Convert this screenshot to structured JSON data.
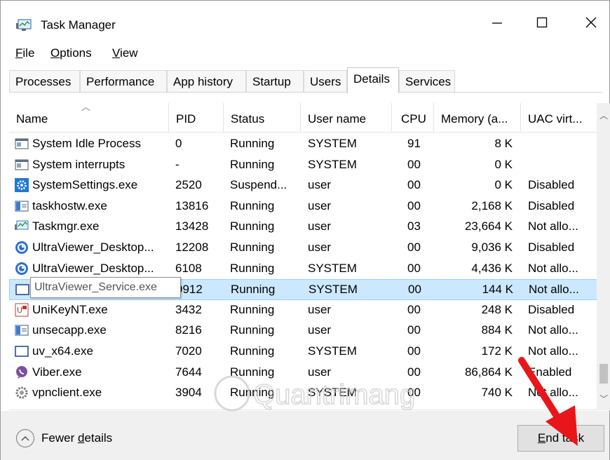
{
  "window": {
    "title": "Task Manager",
    "controls": {
      "minimize": "—",
      "maximize": "☐",
      "close": "✕"
    }
  },
  "menu": [
    {
      "label": "File",
      "underline": "F",
      "rest": "ile"
    },
    {
      "label": "Options",
      "underline": "O",
      "rest": "ptions"
    },
    {
      "label": "View",
      "underline": "V",
      "rest": "iew"
    }
  ],
  "tabs": [
    "Processes",
    "Performance",
    "App history",
    "Startup",
    "Users",
    "Details",
    "Services"
  ],
  "active_tab": "Details",
  "columns": [
    "Name",
    "PID",
    "Status",
    "User name",
    "CPU",
    "Memory (a...",
    "UAC virt..."
  ],
  "rows": [
    {
      "name": "System Idle Process",
      "pid": "0",
      "status": "Running",
      "user": "SYSTEM",
      "cpu": "91",
      "memory": "8 K",
      "uac": "",
      "icon": "window-icon"
    },
    {
      "name": "System interrupts",
      "pid": "-",
      "status": "Running",
      "user": "SYSTEM",
      "cpu": "00",
      "memory": "0 K",
      "uac": "",
      "icon": "window-icon"
    },
    {
      "name": "SystemSettings.exe",
      "pid": "2520",
      "status": "Suspend...",
      "user": "user",
      "cpu": "00",
      "memory": "0 K",
      "uac": "Disabled",
      "icon": "settings-gear-icon"
    },
    {
      "name": "taskhostw.exe",
      "pid": "13816",
      "status": "Running",
      "user": "user",
      "cpu": "00",
      "memory": "2,168 K",
      "uac": "Disabled",
      "icon": "app-window-icon"
    },
    {
      "name": "Taskmgr.exe",
      "pid": "13428",
      "status": "Running",
      "user": "user",
      "cpu": "03",
      "memory": "23,664 K",
      "uac": "Not allo...",
      "icon": "task-manager-icon"
    },
    {
      "name": "UltraViewer_Desktop...",
      "pid": "12208",
      "status": "Running",
      "user": "user",
      "cpu": "00",
      "memory": "9,036 K",
      "uac": "Disabled",
      "icon": "ultraviewer-icon"
    },
    {
      "name": "UltraViewer_Desktop...",
      "pid": "6108",
      "status": "Running",
      "user": "SYSTEM",
      "cpu": "00",
      "memory": "4,436 K",
      "uac": "Not allo...",
      "icon": "ultraviewer-icon"
    },
    {
      "name": "UltraViewer_Service.exe",
      "pid": "9912",
      "status": "Running",
      "user": "SYSTEM",
      "cpu": "00",
      "memory": "144 K",
      "uac": "Not allo...",
      "icon": "service-window-icon"
    },
    {
      "name": "UniKeyNT.exe",
      "pid": "3432",
      "status": "Running",
      "user": "user",
      "cpu": "00",
      "memory": "248 K",
      "uac": "Disabled",
      "icon": "unikey-icon"
    },
    {
      "name": "unsecapp.exe",
      "pid": "8216",
      "status": "Running",
      "user": "user",
      "cpu": "00",
      "memory": "884 K",
      "uac": "Not allo...",
      "icon": "app-window-icon"
    },
    {
      "name": "uv_x64.exe",
      "pid": "7020",
      "status": "Running",
      "user": "SYSTEM",
      "cpu": "00",
      "memory": "172 K",
      "uac": "Not allo...",
      "icon": "service-window-icon"
    },
    {
      "name": "Viber.exe",
      "pid": "7644",
      "status": "Running",
      "user": "user",
      "cpu": "00",
      "memory": "86,864 K",
      "uac": "Enabled",
      "icon": "viber-icon"
    },
    {
      "name": "vpnclient.exe",
      "pid": "3904",
      "status": "Running",
      "user": "SYSTEM",
      "cpu": "00",
      "memory": "740 K",
      "uac": "Not allo...",
      "icon": "vpn-gear-icon"
    }
  ],
  "selected_row_index": 7,
  "tooltip": "UltraViewer_Service.exe",
  "footer": {
    "fewer_details": "Fewer details",
    "fewer_underline_prefix": "Fewer ",
    "fewer_underline_char": "d",
    "fewer_rest": "etails",
    "end_task": "End task",
    "end_task_underline": "E",
    "end_task_rest": "nd task"
  },
  "watermark": "Quantrimang",
  "colors": {
    "selection": "#cce8ff",
    "selection_border": "#99d1ff",
    "footer_bg": "#f0f0f0",
    "annotation_arrow": "#e8151b"
  }
}
